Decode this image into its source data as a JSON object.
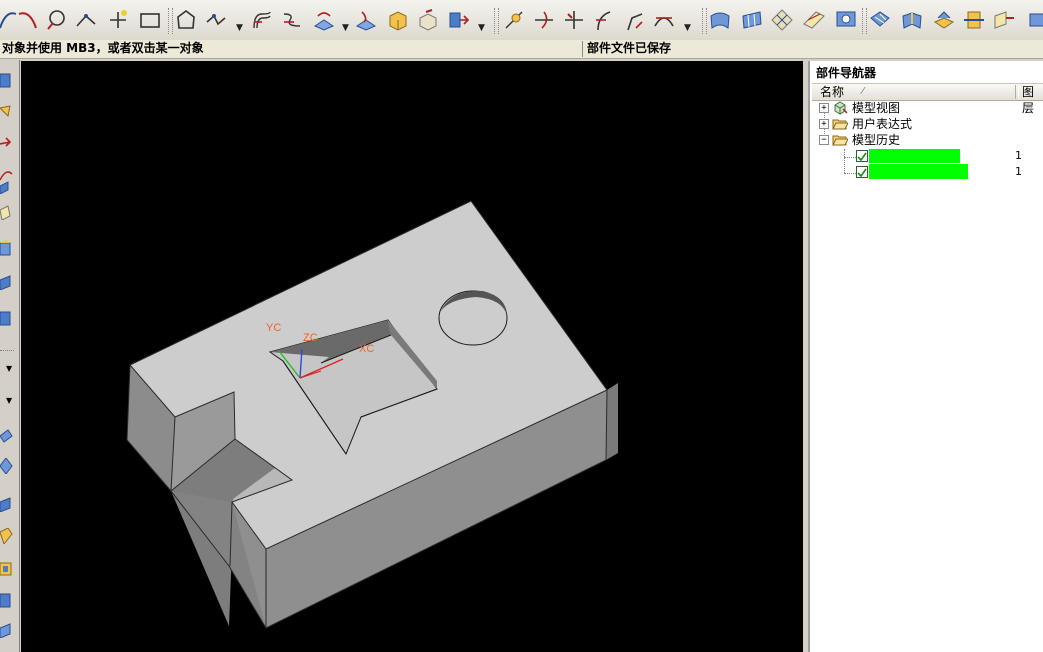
{
  "toolbar": {
    "icons": [
      "arc-icon",
      "arc-icon",
      "circle-icon",
      "spline-icon",
      "point-icon",
      "rectangle-icon",
      "polygon-icon",
      "curve-dropdown-icon",
      "offset-curve-icon",
      "bridge-curve-icon",
      "project-curve-icon",
      "extract-curve-icon",
      "join-curve-icon",
      "sketch-icon",
      "divide-icon",
      "analyze-curve-icon",
      "trim-icon",
      "split-curve-icon",
      "fillet-curve-icon",
      "chamfer-curve-icon",
      "curve-edit-icon",
      "surface-icon",
      "ruled-surface-icon",
      "mesh-surface-icon",
      "sweep-surface-icon",
      "view-surface-icon",
      "bounded-plane-icon",
      "offset-surface-icon",
      "extend-surface-icon",
      "trim-body-icon",
      "sew-icon",
      "view-icon"
    ]
  },
  "status": {
    "prompt": "对象并使用 MB3，或者双击某一对象",
    "message": "部件文件已保存"
  },
  "viewport": {
    "background": "#000000",
    "face_top_color": "#cdcdcd",
    "face_side_color": "#8c8c8c",
    "axis_labels": {
      "yc": "YC",
      "zc": "ZC",
      "xc": "XC"
    },
    "axis_label_color": "#e8662a"
  },
  "navigator": {
    "title": "部件导航器",
    "columns": {
      "name": "名称",
      "sort_marker": "⁄",
      "layer": "图层"
    },
    "tree": [
      {
        "label": "模型视图",
        "expanded": false,
        "icon": "model-view-icon"
      },
      {
        "label": "用户表达式",
        "expanded": false,
        "icon": "folder-icon"
      },
      {
        "label": "模型历史",
        "expanded": true,
        "icon": "folder-open-icon"
      }
    ],
    "history": [
      {
        "checked": true,
        "layer": "1"
      },
      {
        "checked": true,
        "layer": "1"
      }
    ],
    "redaction_color": "#00ff00"
  }
}
